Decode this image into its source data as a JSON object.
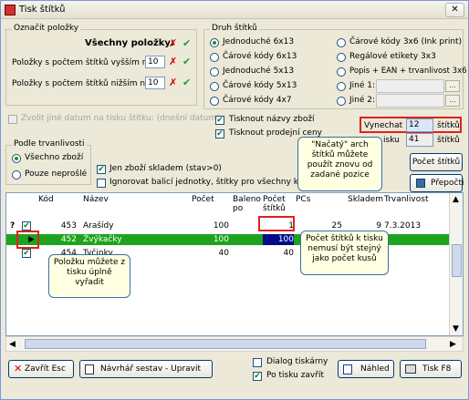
{
  "window": {
    "title": "Tisk štítků",
    "close_glyph": "✕"
  },
  "oznacit": {
    "title": "Označit položky",
    "all_label": "Všechny položky:",
    "higher_label": "Položky s počtem štítků vyšším než:",
    "higher_value": "10",
    "lower_label": "Položky s počtem štítků nižším než:",
    "lower_value": "10",
    "x_glyph": "✗",
    "check_glyph": "✔"
  },
  "druh": {
    "title": "Druh štítků",
    "left": [
      "Jednoduché 6x13",
      "Čárové kódy 6x13",
      "Jednoduché 5x13",
      "Čárové kódy 5x13",
      "Čárové kódy 4x7"
    ],
    "right": [
      "Čárové kódy 3x6 (Ink print)",
      "Regálové etikety 3x3",
      "Popis + EAN + trvanlivost 3x6",
      "Jiné 1:",
      "Jiné 2:"
    ],
    "selected": "Jednoduché 6x13",
    "ellipsis_glyph": "…"
  },
  "options": {
    "date_label": "Zvolit jiné datum na tisku štítku: (dnešní datum)",
    "print_name": "Tisknout názvy zboží",
    "print_price": "Tisknout prodejní ceny",
    "skip_label": "Vynechat",
    "skip_value": "12",
    "skip_unit": "štítků",
    "count_label": "isku",
    "count_value": "41",
    "count_unit": "štítků"
  },
  "trvanlivost": {
    "title": "Podle trvanlivosti",
    "all": "Všechno zboží",
    "expired": "Pouze neprošlé"
  },
  "filters": {
    "stock_only": "Jen zboží skladem (stav>0)",
    "ignore_units": "Ignorovat balicí jednotky, štítky pro všechny kusy"
  },
  "callouts": {
    "started": "\"Načatý\" arch štítků můžete použít znovu od zadané pozice",
    "count_note": "Počet štítků k tisku nemusí být stejný jako počet kusů",
    "remove_note": "Položku můžete z tisku úplně vyřadit"
  },
  "side_buttons": {
    "count": "Počet štítků",
    "recalc": "Přepočti"
  },
  "table": {
    "headers": [
      "Kód",
      "Název",
      "Počet",
      "Baleno po",
      "Počet štítků",
      "PCs",
      "Skladem",
      "Trvanlivost"
    ],
    "rows": [
      {
        "mark": "?",
        "checked": true,
        "code": "453",
        "name": "Arašídy",
        "count": "100",
        "pack": "",
        "labels": "1",
        "pcs": "25",
        "stock": "9",
        "expiry": "7.3.2013"
      },
      {
        "mark": "▶",
        "checked": true,
        "code": "452",
        "name": "Žvýkačky",
        "count": "100",
        "pack": "",
        "labels": "100",
        "pcs": "",
        "stock": "",
        "expiry": ""
      },
      {
        "mark": "",
        "checked": true,
        "code": "454",
        "name": "Tyčinky",
        "count": "40",
        "pack": "",
        "labels": "40",
        "pcs": "",
        "stock": "",
        "expiry": ""
      }
    ]
  },
  "bottom": {
    "close": "Zavřít  Esc",
    "designer": "Návrhář sestav - Upravit",
    "dialog": "Dialog tiskárny",
    "close_after": "Po tisku zavřít",
    "preview": "Náhled",
    "print": "Tisk  F8"
  },
  "colors": {
    "selected_row": "#1ea31e",
    "highlight": "#e02020",
    "callout": "#ffffe1"
  }
}
